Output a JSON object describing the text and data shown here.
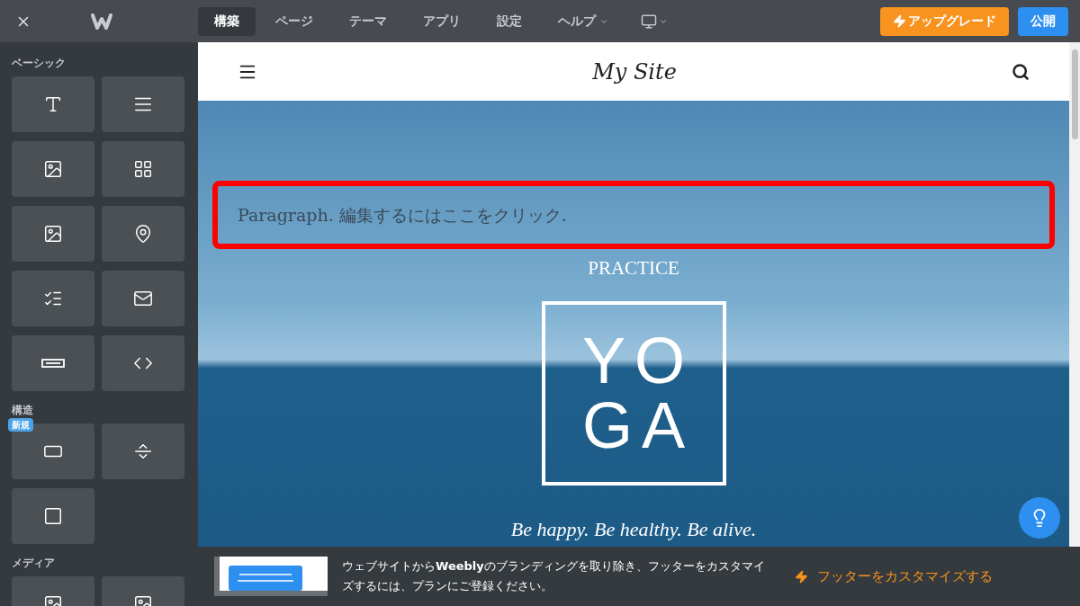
{
  "nav_tabs": [
    {
      "label": "構築",
      "selected": true
    },
    {
      "label": "ページ",
      "selected": false
    },
    {
      "label": "テーマ",
      "selected": false
    },
    {
      "label": "アプリ",
      "selected": false
    },
    {
      "label": "設定",
      "selected": false
    },
    {
      "label": "ヘルプ",
      "selected": false
    }
  ],
  "upgrade_button": "アップグレード",
  "publish_button": "公開",
  "sidebar_sections": [
    {
      "title": "ベーシック"
    },
    {
      "title": "構造",
      "badge": "新規"
    },
    {
      "title": "メディア"
    }
  ],
  "site_header": {
    "title": "My Site"
  },
  "hero": {
    "paragraph": "Paragraph. 編集するにはここをクリック.",
    "subtitle": "PRACTICE",
    "logo_lines": [
      "YO",
      "GA"
    ],
    "tagline": "Be happy. Be healthy. Be alive."
  },
  "footer_notice": {
    "message": "ウェブサイトから**Weebly**のブランディングを取り除き、フッターをカスタマイズするには、プランにご登録ください。",
    "link": "フッターをカスタマイズする"
  }
}
